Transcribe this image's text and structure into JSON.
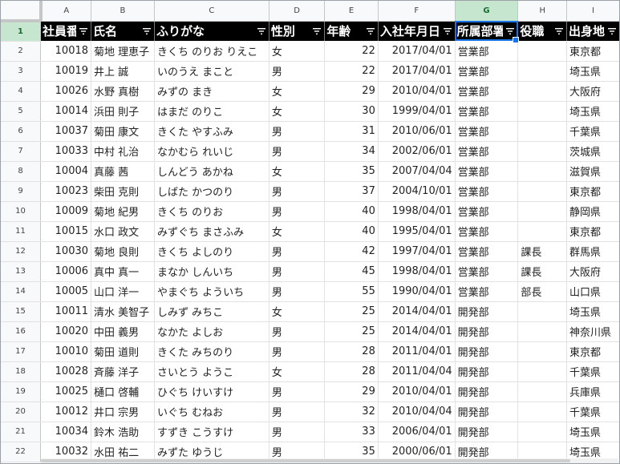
{
  "columns": [
    "A",
    "B",
    "C",
    "D",
    "E",
    "F",
    "G",
    "H",
    "I"
  ],
  "selected_column": "G",
  "header_row_number": "1",
  "headers": [
    "社員番号",
    "氏名",
    "ふりがな",
    "性別",
    "年齢",
    "入社年月日",
    "所属部署",
    "役職",
    "出身地"
  ],
  "rows": [
    {
      "num": "2",
      "cells": [
        "10018",
        "菊地 理恵子",
        "きくち のりお りえこ",
        "女",
        "22",
        "2017/04/01",
        "営業部",
        "",
        "東京都"
      ]
    },
    {
      "num": "3",
      "cells": [
        "10019",
        "井上 誠",
        "いのうえ まこと",
        "男",
        "22",
        "2017/04/01",
        "営業部",
        "",
        "埼玉県"
      ]
    },
    {
      "num": "4",
      "cells": [
        "10026",
        "水野 真樹",
        "みずの まき",
        "女",
        "29",
        "2010/04/01",
        "営業部",
        "",
        "大阪府"
      ]
    },
    {
      "num": "5",
      "cells": [
        "10014",
        "浜田 則子",
        "はまだ のりこ",
        "女",
        "30",
        "1999/04/01",
        "営業部",
        "",
        "埼玉県"
      ]
    },
    {
      "num": "6",
      "cells": [
        "10037",
        "菊田 康文",
        "きくた やすふみ",
        "男",
        "31",
        "2010/06/01",
        "営業部",
        "",
        "千葉県"
      ]
    },
    {
      "num": "7",
      "cells": [
        "10033",
        "中村 礼治",
        "なかむら れいじ",
        "男",
        "34",
        "2002/06/01",
        "営業部",
        "",
        "茨城県"
      ]
    },
    {
      "num": "8",
      "cells": [
        "10004",
        "真藤 茜",
        "しんどう あかね",
        "女",
        "35",
        "2007/04/04",
        "営業部",
        "",
        "滋賀県"
      ]
    },
    {
      "num": "9",
      "cells": [
        "10023",
        "柴田 克則",
        "しばた かつのり",
        "男",
        "37",
        "2004/10/01",
        "営業部",
        "",
        "東京都"
      ]
    },
    {
      "num": "10",
      "cells": [
        "10009",
        "菊地 紀男",
        "きくち のりお",
        "男",
        "40",
        "1998/04/01",
        "営業部",
        "",
        "静岡県"
      ]
    },
    {
      "num": "11",
      "cells": [
        "10015",
        "水口 政文",
        "みずぐち まさふみ",
        "女",
        "40",
        "1995/04/01",
        "営業部",
        "",
        "東京都"
      ]
    },
    {
      "num": "12",
      "cells": [
        "10030",
        "菊地 良則",
        "きくち よしのり",
        "男",
        "42",
        "1997/04/01",
        "営業部",
        "課長",
        "群馬県"
      ]
    },
    {
      "num": "13",
      "cells": [
        "10006",
        "真中 真一",
        "まなか しんいち",
        "男",
        "45",
        "1998/04/01",
        "営業部",
        "課長",
        "大阪府"
      ]
    },
    {
      "num": "14",
      "cells": [
        "10005",
        "山口 洋一",
        "やまぐち よういち",
        "男",
        "55",
        "1990/04/01",
        "営業部",
        "部長",
        "山口県"
      ]
    },
    {
      "num": "15",
      "cells": [
        "10011",
        "清水 美智子",
        "しみず みちこ",
        "女",
        "25",
        "2014/04/01",
        "開発部",
        "",
        "埼玉県"
      ]
    },
    {
      "num": "16",
      "cells": [
        "10020",
        "中田 義男",
        "なかた よしお",
        "男",
        "25",
        "2014/04/01",
        "開発部",
        "",
        "神奈川県"
      ]
    },
    {
      "num": "17",
      "cells": [
        "10010",
        "菊田 道則",
        "きくた みちのり",
        "男",
        "28",
        "2011/04/01",
        "開発部",
        "",
        "東京都"
      ]
    },
    {
      "num": "18",
      "cells": [
        "10028",
        "斉藤 洋子",
        "さいとう ようこ",
        "女",
        "28",
        "2011/04/04",
        "開発部",
        "",
        "千葉県"
      ]
    },
    {
      "num": "19",
      "cells": [
        "10025",
        "樋口 啓輔",
        "ひぐち けいすけ",
        "男",
        "29",
        "2010/04/01",
        "開発部",
        "",
        "兵庫県"
      ]
    },
    {
      "num": "20",
      "cells": [
        "10012",
        "井口 宗男",
        "いぐち むねお",
        "男",
        "32",
        "2010/04/04",
        "開発部",
        "",
        "千葉県"
      ]
    },
    {
      "num": "21",
      "cells": [
        "10034",
        "鈴木 浩助",
        "すずき こうすけ",
        "男",
        "33",
        "2006/04/01",
        "開発部",
        "",
        "埼玉県"
      ]
    },
    {
      "num": "22",
      "cells": [
        "10032",
        "水田 祐二",
        "みずた ゆうじ",
        "男",
        "35",
        "2000/06/01",
        "開発部",
        "",
        "埼玉県"
      ]
    }
  ],
  "icons": {
    "filter": "filter-icon"
  }
}
